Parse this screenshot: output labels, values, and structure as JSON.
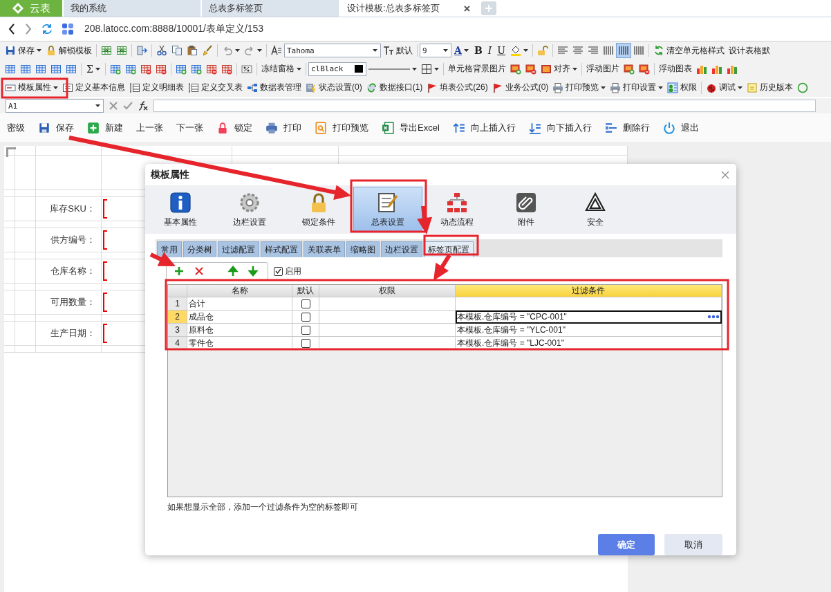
{
  "browser_tabs": [
    {
      "kind": "brand",
      "label": "云表",
      "selected": false
    },
    {
      "kind": "page",
      "label": "我的系统",
      "selected": false
    },
    {
      "kind": "page",
      "label": "总表多标签页",
      "selected": false
    },
    {
      "kind": "page",
      "label": "设计模板:总表多标签页",
      "selected": true
    }
  ],
  "address": {
    "url": "208.latocc.com:8888/10001/表单定义/153"
  },
  "toolbars": [
    [
      {
        "kind": "save",
        "label": "保存",
        "caret": true
      },
      {
        "kind": "padlock",
        "label": "解锁模板"
      },
      {
        "kind": "sep"
      },
      {
        "kind": "sheet-in"
      },
      {
        "kind": "sheet-out"
      },
      {
        "kind": "sep"
      },
      {
        "kind": "exit"
      },
      {
        "kind": "sep"
      },
      {
        "kind": "cut"
      },
      {
        "kind": "copy"
      },
      {
        "kind": "paste"
      },
      {
        "kind": "brush"
      },
      {
        "kind": "sep"
      },
      {
        "kind": "undo",
        "caret": true
      },
      {
        "kind": "redo",
        "caret": true
      },
      {
        "kind": "sep"
      },
      {
        "kind": "font"
      },
      {
        "kind": "font-combo",
        "value": "Tahoma"
      },
      {
        "kind": "text-size",
        "label": "默认"
      },
      {
        "kind": "sep"
      },
      {
        "kind": "size-combo",
        "value": "9"
      },
      {
        "kind": "color-glyph",
        "label": "A",
        "caret": true
      },
      {
        "kind": "bold",
        "label": "B"
      },
      {
        "kind": "italic",
        "label": "I"
      },
      {
        "kind": "underline",
        "label": "U"
      },
      {
        "kind": "fill",
        "caret": true
      },
      {
        "kind": "sep"
      },
      {
        "kind": "padlock-open"
      },
      {
        "kind": "sep"
      },
      {
        "kind": "align-left"
      },
      {
        "kind": "align-center"
      },
      {
        "kind": "align-right"
      },
      {
        "kind": "bars",
        "selected": false
      },
      {
        "kind": "bars",
        "selected": true
      },
      {
        "kind": "bars",
        "selected": false
      },
      {
        "kind": "sep"
      },
      {
        "kind": "refresh",
        "label": "清空单元格样式"
      },
      {
        "kind": "plain",
        "label": "设计表格默"
      }
    ],
    [
      {
        "kind": "table"
      },
      {
        "kind": "table"
      },
      {
        "kind": "table"
      },
      {
        "kind": "table"
      },
      {
        "kind": "table"
      },
      {
        "kind": "sep"
      },
      {
        "kind": "glyph",
        "label": "Σ",
        "caret": true
      },
      {
        "kind": "sep"
      },
      {
        "kind": "insert-row"
      },
      {
        "kind": "insert-col"
      },
      {
        "kind": "delete-row"
      },
      {
        "kind": "delete-col"
      },
      {
        "kind": "sep"
      },
      {
        "kind": "insert-row"
      },
      {
        "kind": "insert-col"
      },
      {
        "kind": "delete-row"
      },
      {
        "kind": "delete-col"
      },
      {
        "kind": "sep"
      },
      {
        "kind": "percent"
      },
      {
        "kind": "sep"
      },
      {
        "kind": "plain",
        "label": "冻结窗格",
        "caret": true
      },
      {
        "kind": "sep"
      },
      {
        "kind": "color-combo",
        "value": "clBlack",
        "color": "#000000"
      },
      {
        "kind": "line-style",
        "caret": true
      },
      {
        "kind": "border",
        "caret": true
      },
      {
        "kind": "sep"
      },
      {
        "kind": "plain",
        "label": "单元格背景图片"
      },
      {
        "kind": "image-add"
      },
      {
        "kind": "image-remove"
      },
      {
        "kind": "image-frame",
        "label": "对齐",
        "caret": true
      },
      {
        "kind": "sep"
      },
      {
        "kind": "plain",
        "label": "浮动图片"
      },
      {
        "kind": "image-add"
      },
      {
        "kind": "image-remove"
      },
      {
        "kind": "sep"
      },
      {
        "kind": "plain",
        "label": "浮动图表"
      },
      {
        "kind": "chart-add"
      },
      {
        "kind": "chart-edit"
      },
      {
        "kind": "chart-remove"
      }
    ],
    [
      {
        "kind": "card",
        "label": "模板属性",
        "caret": true
      },
      {
        "kind": "form",
        "label": "定义基本信息"
      },
      {
        "kind": "columns",
        "label": "定义明细表"
      },
      {
        "kind": "columns",
        "label": "定义交叉表"
      },
      {
        "kind": "network",
        "label": "数据表管理"
      },
      {
        "kind": "server",
        "label": "状态设置(0)"
      },
      {
        "kind": "sync",
        "label": "数据接口(1)"
      },
      {
        "kind": "flag",
        "label": "填表公式(26)"
      },
      {
        "kind": "flag",
        "label": "业务公式(0)"
      },
      {
        "kind": "printer",
        "label": "打印预览",
        "caret": true
      },
      {
        "kind": "printer",
        "label": "打印设置",
        "caret": true
      },
      {
        "kind": "users",
        "label": "权限"
      },
      {
        "kind": "sep"
      },
      {
        "kind": "bug",
        "label": "调试",
        "caret": true
      },
      {
        "kind": "note",
        "label": "历史版本"
      },
      {
        "kind": "help"
      }
    ]
  ],
  "formula_bar": {
    "cell": "A1"
  },
  "actions": [
    {
      "kind": "plain",
      "label": "密级"
    },
    {
      "kind": "save",
      "label": "保存"
    },
    {
      "kind": "new",
      "label": "新建"
    },
    {
      "kind": "plain",
      "label": "上一张"
    },
    {
      "kind": "plain",
      "label": "下一张"
    },
    {
      "kind": "lock",
      "label": "锁定"
    },
    {
      "kind": "print",
      "label": "打印"
    },
    {
      "kind": "preview",
      "label": "打印预览"
    },
    {
      "kind": "excel",
      "label": "导出Excel"
    },
    {
      "kind": "row-up",
      "label": "向上插入行"
    },
    {
      "kind": "row-down",
      "label": "向下插入行"
    },
    {
      "kind": "row-delete",
      "label": "删除行"
    },
    {
      "kind": "power",
      "label": "退出"
    }
  ],
  "sheet": {
    "labels": [
      "库存SKU：",
      "供方编号：",
      "仓库名称：",
      "可用数量：",
      "生产日期："
    ]
  },
  "dialog": {
    "title": "模板属性",
    "categories": [
      {
        "kind": "info",
        "label": "基本属性",
        "selected": false
      },
      {
        "kind": "gear",
        "label": "边栏设置",
        "selected": false
      },
      {
        "kind": "padlock",
        "label": "锁定条件",
        "selected": false
      },
      {
        "kind": "edit",
        "label": "总表设置",
        "selected": true
      },
      {
        "kind": "org",
        "label": "动态流程",
        "selected": false
      },
      {
        "kind": "clip",
        "label": "附件",
        "selected": false
      },
      {
        "kind": "recycle",
        "label": "安全",
        "selected": false
      }
    ],
    "tabs": [
      {
        "label": "常用",
        "selected": false
      },
      {
        "label": "分类树",
        "selected": false
      },
      {
        "label": "过滤配置",
        "selected": false
      },
      {
        "label": "样式配置",
        "selected": false
      },
      {
        "label": "关联表单",
        "selected": false
      },
      {
        "label": "缩略图",
        "selected": false
      },
      {
        "label": "边栏设置",
        "selected": false
      },
      {
        "label": "标签页配置",
        "selected": true
      }
    ],
    "tools": [
      {
        "kind": "add"
      },
      {
        "kind": "remove"
      },
      {
        "kind": "up"
      },
      {
        "kind": "down"
      }
    ],
    "enabled": {
      "label": "启用",
      "checked": true
    },
    "columns": [
      {
        "label": "名称",
        "selected": false
      },
      {
        "label": "默认",
        "selected": false
      },
      {
        "label": "权限",
        "selected": false
      },
      {
        "label": "过滤条件",
        "selected": true
      }
    ],
    "rows": [
      {
        "index": "1",
        "name": "合计",
        "default": false,
        "selected": false
      },
      {
        "index": "2",
        "name": "成品仓",
        "default": false,
        "selected": true,
        "filter": "本模板.仓库编号  =  \"CPC-001\""
      },
      {
        "index": "3",
        "name": "原料仓",
        "default": false,
        "selected": false,
        "filter": "本模板.仓库编号  =  \"YLC-001\""
      },
      {
        "index": "4",
        "name": "零件仓",
        "default": false,
        "selected": false,
        "filter": "本模板.仓库编号  =  \"LJC-001\""
      }
    ],
    "hint": "如果想显示全部，添加一个过滤条件为空的标签即可",
    "buttons": [
      {
        "kind": "primary",
        "label": "确定"
      },
      {
        "kind": "secondary",
        "label": "取消"
      }
    ]
  }
}
